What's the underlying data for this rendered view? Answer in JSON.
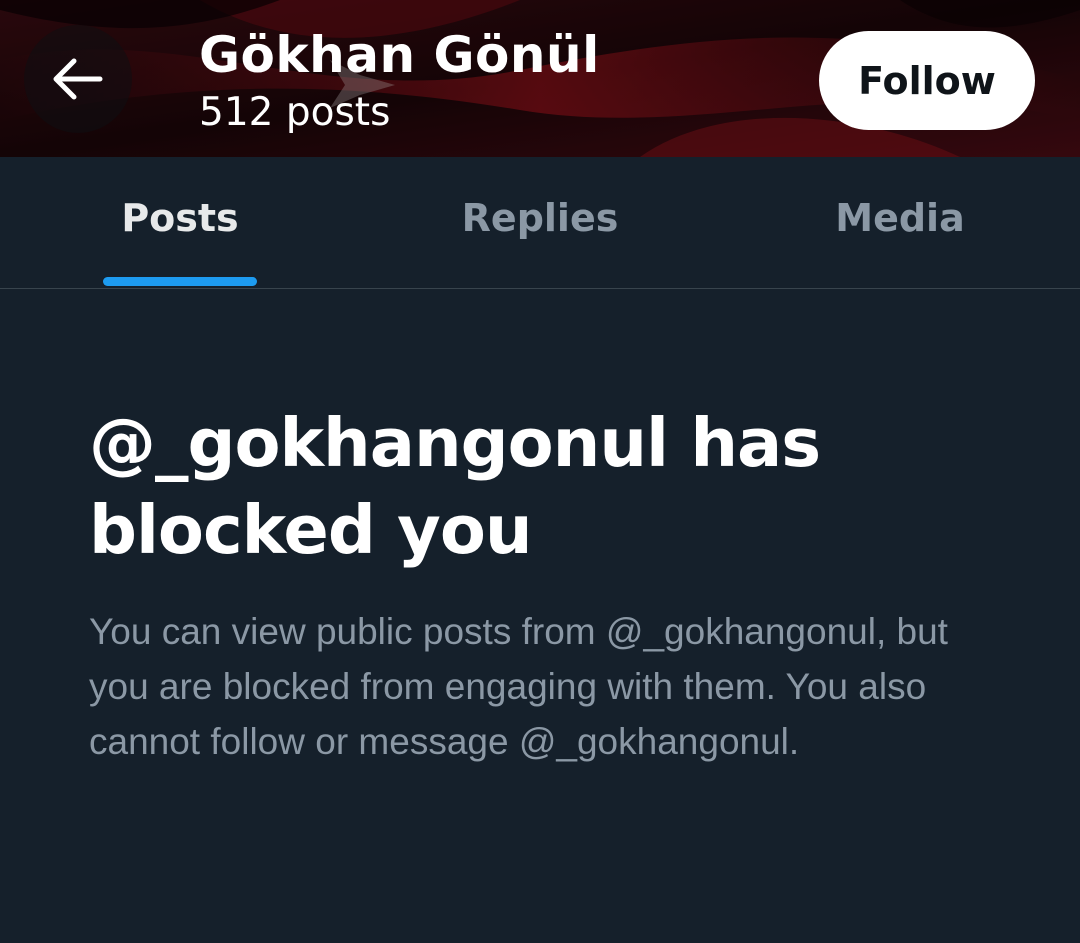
{
  "header": {
    "back_icon": "arrow-left-icon",
    "profile_name": "Gökhan Gönül",
    "post_count": "512 posts",
    "follow_label": "Follow",
    "banner_colors": [
      "#2a0a0e",
      "#7a0f18",
      "#c01a24"
    ]
  },
  "tabs": [
    {
      "label": "Posts",
      "active": true
    },
    {
      "label": "Replies",
      "active": false
    },
    {
      "label": "Media",
      "active": false
    }
  ],
  "blocked": {
    "title": "@_gokhangonul has blocked you",
    "body": "You can view public posts from @_gokhangonul, but you are blocked from engaging with them. You also cannot follow or message @_gokhangonul."
  },
  "colors": {
    "background": "#15202b",
    "accent": "#1d9bf0",
    "muted_text": "#8b98a5",
    "divider": "#38444d"
  }
}
